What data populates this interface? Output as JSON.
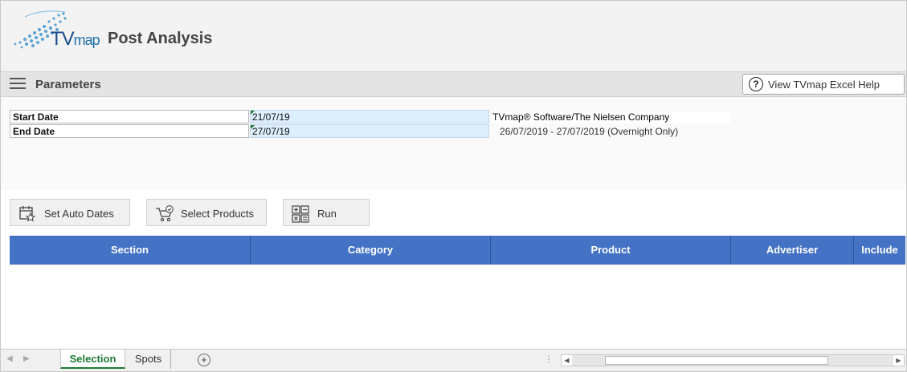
{
  "header": {
    "logo_text_main": "TV",
    "logo_text_small": "map",
    "title": "Post Analysis"
  },
  "params_bar": {
    "label": "Parameters",
    "help_button": "View TVmap Excel Help",
    "help_icon": "?"
  },
  "form": {
    "start_label": "Start Date",
    "start_value": "21/07/19",
    "end_label": "End Date",
    "end_value": "27/07/19",
    "credit": "TVmap® Software/The Nielsen Company",
    "overnight": "26/07/2019 - 27/07/2019 (Overnight Only)"
  },
  "buttons": {
    "auto_dates": "Set Auto Dates",
    "select_products": "Select Products",
    "run": "Run"
  },
  "table": {
    "columns": [
      "Section",
      "Category",
      "Product",
      "Advertiser",
      "Include"
    ]
  },
  "sheets": {
    "active": "Selection",
    "other": "Spots",
    "add": "+"
  },
  "nav": {
    "prev": "◀",
    "next": "▶",
    "dots": "⋮",
    "scroll_left": "◀",
    "scroll_right": "▶"
  },
  "colors": {
    "header_blue": "#4472c4",
    "input_blue": "#ddeefc",
    "active_tab_green": "#1e7b34"
  }
}
